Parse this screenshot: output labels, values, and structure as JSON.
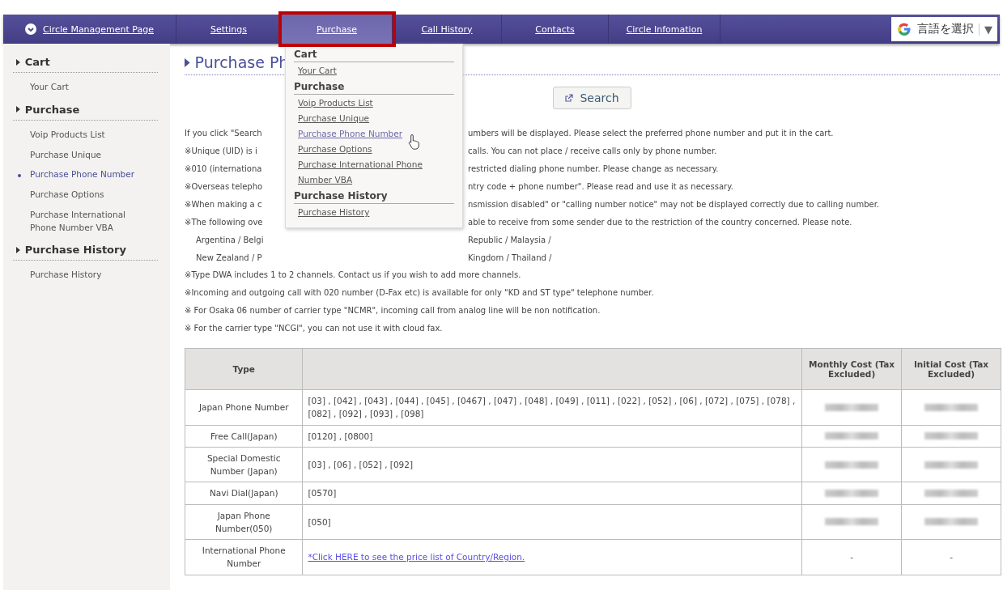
{
  "nav": [
    {
      "label": "Circle Management Page",
      "kind": "home",
      "highlighted": false
    },
    {
      "label": "Settings",
      "kind": "link",
      "highlighted": false
    },
    {
      "label": "Purchase",
      "kind": "link",
      "highlighted": true
    },
    {
      "label": "Call History",
      "kind": "link",
      "highlighted": false
    },
    {
      "label": "Contacts",
      "kind": "link",
      "highlighted": false
    },
    {
      "label": "Circle Infomation",
      "kind": "link",
      "highlighted": false
    }
  ],
  "translate": {
    "label": "言語を選択",
    "arrow": "▼"
  },
  "sidebar": [
    {
      "heading": "Cart",
      "items": [
        {
          "label": "Your Cart",
          "selected": false
        }
      ]
    },
    {
      "heading": "Purchase",
      "items": [
        {
          "label": "Voip Products List",
          "selected": false
        },
        {
          "label": "Purchase Unique",
          "selected": false
        },
        {
          "label": "Purchase Phone Number",
          "selected": true
        },
        {
          "label": "Purchase Options",
          "selected": false
        },
        {
          "label": "Purchase International Phone Number VBA",
          "selected": false
        }
      ]
    },
    {
      "heading": "Purchase History",
      "items": [
        {
          "label": "Purchase History",
          "selected": false
        }
      ]
    }
  ],
  "title": "Purchase Ph",
  "dropdown": [
    {
      "heading": "Cart",
      "items": [
        {
          "label": "Your Cart",
          "selected": false
        }
      ]
    },
    {
      "heading": "Purchase",
      "items": [
        {
          "label": "Voip Products List",
          "selected": false
        },
        {
          "label": "Purchase Unique",
          "selected": false
        },
        {
          "label": "Purchase Phone Number",
          "selected": true
        },
        {
          "label": "Purchase Options",
          "selected": false
        },
        {
          "label": "Purchase International Phone",
          "selected": false
        },
        {
          "label": "Number VBA",
          "selected": false
        }
      ]
    },
    {
      "heading": "Purchase History",
      "items": [
        {
          "label": "Purchase History",
          "selected": false
        }
      ]
    }
  ],
  "search_button": "Search",
  "notes": [
    {
      "left": "If you click \"Search",
      "right": "umbers will be displayed. Please select the preferred phone number and put it in the cart.",
      "indent": false
    },
    {
      "left": "※Unique (UID) is i",
      "right": "calls. You can not place / receive calls only by phone number.",
      "indent": false
    },
    {
      "left": "※010 (internationa",
      "right": "restricted dialing phone number. Please change as necessary.",
      "indent": false
    },
    {
      "left": "※Overseas telepho",
      "right": "ntry code + phone number\". Please read and use it as necessary.",
      "indent": false
    },
    {
      "left": "※When making a c",
      "right": "nsmission disabled\" or \"calling number notice\" may not be displayed correctly due to calling number.",
      "indent": false
    },
    {
      "left": "※The following ove",
      "right": "able to receive from some sender due to the restriction of the country concerned. Please note.",
      "indent": false
    },
    {
      "left": "Argentina / Belgi",
      "right": "Republic / Malaysia /",
      "indent": true
    },
    {
      "left": "New Zealand / P",
      "right": "Kingdom / Thailand /",
      "indent": true
    },
    {
      "text": "※Type DWA includes 1 to 2 channels. Contact us if you wish to add more channels."
    },
    {
      "text": "※Incoming and outgoing call with 020 number (D-Fax etc) is available for only \"KD and ST type\" telephone number."
    },
    {
      "text": "※ For Osaka 06 number of carrier type \"NCMR\", incoming call from analog line will be non notification."
    },
    {
      "text": "※ For the carrier type \"NCGI\", you can not use it with cloud fax."
    }
  ],
  "table": {
    "columns": [
      "Type",
      "Monthly Cost (Tax Excluded)",
      "Initial Cost (Tax Excluded)"
    ],
    "rows": [
      {
        "type": "Japan Phone Number",
        "numbers": "[03] , [042] , [043] , [044] , [045] , [0467] , [047] , [048] , [049] , [011] , [022] , [052] , [06] , [072] , [075] , [078] , [082] , [092] , [093] , [098]",
        "link": false,
        "monthly": {
          "kind": "blurred"
        },
        "initial": {
          "kind": "blurred"
        }
      },
      {
        "type": "Free Call(Japan)",
        "numbers": "[0120] , [0800]",
        "link": false,
        "monthly": {
          "kind": "blurred"
        },
        "initial": {
          "kind": "blurred"
        }
      },
      {
        "type": "Special Domestic Number (Japan)",
        "numbers": "[03] , [06] , [052] , [092]",
        "link": false,
        "monthly": {
          "kind": "blurred"
        },
        "initial": {
          "kind": "blurred"
        }
      },
      {
        "type": "Navi Dial(Japan)",
        "numbers": "[0570]",
        "link": false,
        "monthly": {
          "kind": "blurred"
        },
        "initial": {
          "kind": "blurred"
        }
      },
      {
        "type": "Japan Phone Number(050)",
        "numbers": "[050]",
        "link": false,
        "monthly": {
          "kind": "blurred"
        },
        "initial": {
          "kind": "blurred"
        }
      },
      {
        "type": "International Phone Number",
        "numbers": "*Click HERE to see the price list of Country/Region.",
        "link": true,
        "monthly": {
          "kind": "text",
          "text": "-"
        },
        "initial": {
          "kind": "text",
          "text": "-"
        }
      }
    ]
  }
}
